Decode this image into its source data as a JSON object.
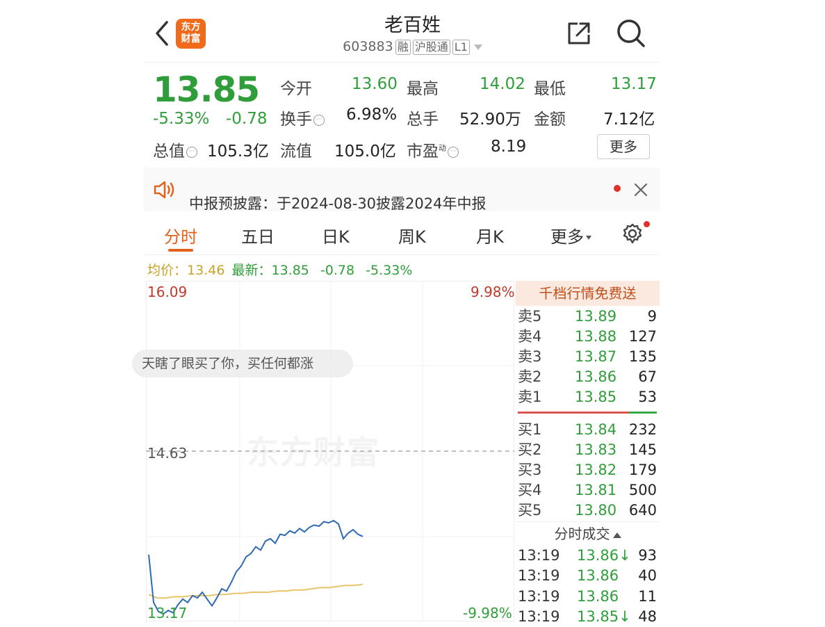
{
  "header": {
    "title": "老百姓",
    "code": "603883",
    "tags": [
      "融",
      "沪股通",
      "L1"
    ],
    "logo_line1": "东方",
    "logo_line2": "财富"
  },
  "quote": {
    "price": "13.85",
    "change_pct": "-5.33%",
    "change": "-0.78",
    "open_label": "今开",
    "open": "13.60",
    "high_label": "最高",
    "high": "14.02",
    "low_label": "最低",
    "low": "13.17",
    "turnover_label": "换手",
    "turnover": "6.98%",
    "volume_label": "总手",
    "volume": "52.90万",
    "amount_label": "金额",
    "amount": "7.12亿",
    "mktcap_label": "总值",
    "mktcap": "105.3亿",
    "float_label": "流值",
    "float": "105.0亿",
    "pe_label": "市盈",
    "pe_sup": "动",
    "pe": "8.19",
    "more_button": "更多"
  },
  "notice": {
    "text": "中报预披露：于2024-08-30披露2024年中报"
  },
  "tabs": [
    {
      "label": "分时"
    },
    {
      "label": "五日"
    },
    {
      "label": "日K"
    },
    {
      "label": "周K"
    },
    {
      "label": "月K"
    },
    {
      "label": "更多"
    }
  ],
  "info_row": {
    "avg_label": "均价：",
    "avg": "13.46",
    "latest_label": "最新：",
    "latest": "13.85",
    "change": "-0.78",
    "change_pct": "-5.33%"
  },
  "chart": {
    "top_price": "16.09",
    "top_pct": "9.98%",
    "mid_price": "14.63",
    "bottom_price": "13.17",
    "bottom_pct": "-9.98%",
    "watermark": "东方财富",
    "comment": "天瞎了眼买了你，买任何都涨"
  },
  "chart_data": {
    "type": "line",
    "ylim": [
      13.17,
      16.09
    ],
    "reference": 14.63,
    "series": [
      {
        "values": [
          13.72,
          13.3,
          13.22,
          13.2,
          13.23,
          13.21,
          13.28,
          13.33,
          13.3,
          13.36,
          13.34,
          13.39,
          13.33,
          13.27,
          13.34,
          13.42,
          13.4,
          13.48,
          13.57,
          13.62,
          13.7,
          13.73,
          13.79,
          13.76,
          13.84,
          13.86,
          13.82,
          13.9,
          13.89,
          13.93,
          13.91,
          13.95,
          13.92,
          13.96,
          13.98,
          13.97,
          14.01,
          14.0,
          14.02,
          13.99,
          13.86,
          13.91,
          13.94,
          13.9,
          13.88
        ]
      },
      {
        "values": [
          13.37,
          13.34,
          13.34,
          13.35,
          13.35,
          13.36,
          13.36,
          13.36,
          13.37,
          13.37,
          13.38,
          13.38,
          13.39,
          13.39,
          13.39,
          13.4,
          13.4,
          13.41,
          13.41,
          13.42,
          13.43,
          13.43,
          13.44,
          13.45,
          13.45,
          13.46
        ]
      }
    ],
    "colors": {
      "price": "#2e6ab3",
      "avg": "#e8c46a"
    }
  },
  "orderbook": {
    "header": "千档行情免费送",
    "asks": [
      {
        "label": "卖5",
        "price": "13.89",
        "vol": "9"
      },
      {
        "label": "卖4",
        "price": "13.88",
        "vol": "127"
      },
      {
        "label": "卖3",
        "price": "13.87",
        "vol": "135"
      },
      {
        "label": "卖2",
        "price": "13.86",
        "vol": "67"
      },
      {
        "label": "卖1",
        "price": "13.85",
        "vol": "53"
      }
    ],
    "bids": [
      {
        "label": "买1",
        "price": "13.84",
        "vol": "232"
      },
      {
        "label": "买2",
        "price": "13.83",
        "vol": "145"
      },
      {
        "label": "买3",
        "price": "13.82",
        "vol": "179"
      },
      {
        "label": "买4",
        "price": "13.81",
        "vol": "500"
      },
      {
        "label": "买5",
        "price": "13.80",
        "vol": "640"
      }
    ]
  },
  "ticks": {
    "title": "分时成交",
    "rows": [
      {
        "time": "13:19",
        "price": "13.86↓",
        "vol": "93"
      },
      {
        "time": "13:19",
        "price": "13.86",
        "vol": "40"
      },
      {
        "time": "13:19",
        "price": "13.86",
        "vol": "11"
      },
      {
        "time": "13:19",
        "price": "13.85↓",
        "vol": "48"
      }
    ]
  },
  "icons": {
    "back": "chevron-left-icon",
    "share": "share-icon",
    "search": "search-icon",
    "speaker": "speaker-icon",
    "close": "close-icon",
    "settings": "gear-icon",
    "more_circle": "ellipsis-circle-icon"
  }
}
